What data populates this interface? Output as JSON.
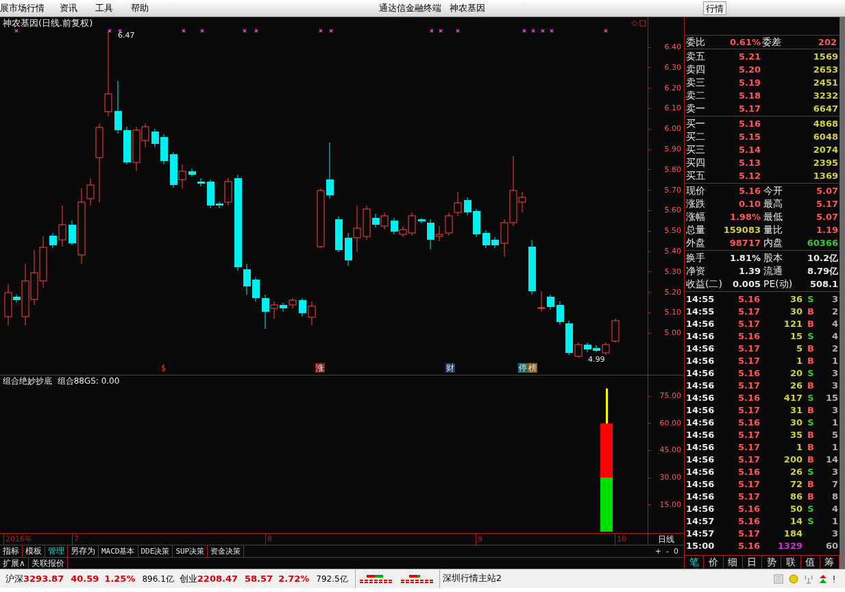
{
  "menu_bar": {
    "items": [
      "展市场行情",
      "资讯",
      "工具",
      "帮助"
    ],
    "app_title": "通达信金融终端",
    "stock_name": "神农基因",
    "buttons": [
      "行情"
    ]
  },
  "chart": {
    "title": "神农基因(日线.前复权)",
    "high_label": "6.47",
    "low_label": "4.99",
    "price_ticks": [
      "6.40",
      "6.30",
      "6.20",
      "6.10",
      "6.00",
      "5.90",
      "5.80",
      "5.70",
      "5.60",
      "5.50",
      "5.40",
      "5.30",
      "5.20",
      "5.10",
      "5.00"
    ],
    "event_tags": [
      {
        "label": "$",
        "color": "#000000"
      },
      {
        "label": "涨",
        "color": "#8b1a1a"
      },
      {
        "label": "财",
        "color": "#1a3a6b"
      },
      {
        "label": "停",
        "color": "#1a6b6b"
      },
      {
        "label": "榜",
        "color": "#8b5a1a"
      }
    ]
  },
  "indicator": {
    "title": "组合绝妙抄底  组合88GS: 0.00",
    "ticks": [
      "75.00",
      "60.00",
      "45.00",
      "30.00",
      "15.00"
    ]
  },
  "date_axis": {
    "labels": [
      "2016年",
      "7",
      "8",
      "9",
      "10"
    ],
    "period": "日线"
  },
  "formula_tabs": [
    {
      "label": "指标",
      "selected": false
    },
    {
      "label": "模板",
      "selected": false
    },
    {
      "label": "管理",
      "selected": true
    },
    {
      "label": "另存为",
      "selected": false
    },
    {
      "label": "MACD基本",
      "selected": false
    },
    {
      "label": "DDE决策",
      "selected": false
    },
    {
      "label": "SUP决策",
      "selected": false
    },
    {
      "label": "资金决策",
      "selected": false
    }
  ],
  "zoom_controls": [
    "+",
    "-",
    "0"
  ],
  "extra_tabs": [
    "扩展∧",
    "关联报价"
  ],
  "quote_panel": {
    "ratio": [
      {
        "label": "委比",
        "value": "0.61%",
        "kind": "up"
      },
      {
        "label": "委差",
        "value": "202",
        "kind": "up"
      }
    ],
    "asks": [
      {
        "label": "卖五",
        "price": "5.21",
        "volume": "1569"
      },
      {
        "label": "卖四",
        "price": "5.20",
        "volume": "2653"
      },
      {
        "label": "卖三",
        "price": "5.19",
        "volume": "2451"
      },
      {
        "label": "卖二",
        "price": "5.18",
        "volume": "3232"
      },
      {
        "label": "卖一",
        "price": "5.17",
        "volume": "6647"
      }
    ],
    "bids": [
      {
        "label": "买一",
        "price": "5.16",
        "volume": "4868"
      },
      {
        "label": "买二",
        "price": "5.15",
        "volume": "6048"
      },
      {
        "label": "买三",
        "price": "5.14",
        "volume": "2074"
      },
      {
        "label": "买四",
        "price": "5.13",
        "volume": "2395"
      },
      {
        "label": "买五",
        "price": "5.12",
        "volume": "1369"
      }
    ],
    "stats": [
      {
        "label": "现价",
        "value": "5.16",
        "kind": "up"
      },
      {
        "label": "今开",
        "value": "5.07",
        "kind": "up"
      },
      {
        "label": "涨跌",
        "value": "0.10",
        "kind": "up"
      },
      {
        "label": "最高",
        "value": "5.17",
        "kind": "up"
      },
      {
        "label": "涨幅",
        "value": "1.98%",
        "kind": "up"
      },
      {
        "label": "最低",
        "value": "5.07",
        "kind": "up"
      },
      {
        "label": "总量",
        "value": "159083",
        "kind": "volume"
      },
      {
        "label": "量比",
        "value": "1.19",
        "kind": "up"
      },
      {
        "label": "外盘",
        "value": "98717",
        "kind": "up"
      },
      {
        "label": "内盘",
        "value": "60366",
        "kind": "down"
      }
    ],
    "fundamentals": [
      {
        "label": "换手",
        "value": "1.81%",
        "kind": "plain"
      },
      {
        "label": "股本",
        "value": "10.2亿",
        "kind": "plain"
      },
      {
        "label": "净资",
        "value": "1.39",
        "kind": "plain"
      },
      {
        "label": "流通",
        "value": "8.79亿",
        "kind": "plain"
      },
      {
        "label": "收益(二)",
        "value": "0.005",
        "kind": "plain"
      },
      {
        "label": "PE(动)",
        "value": "508.1",
        "kind": "plain"
      }
    ],
    "trades": [
      {
        "time": "14:55",
        "price": "5.16",
        "volume": "36",
        "side": "S",
        "count": "3",
        "kind": "sell"
      },
      {
        "time": "14:55",
        "price": "5.17",
        "volume": "30",
        "side": "B",
        "count": "2",
        "kind": "buy"
      },
      {
        "time": "14:56",
        "price": "5.17",
        "volume": "121",
        "side": "B",
        "count": "4",
        "kind": "buy"
      },
      {
        "time": "14:56",
        "price": "5.16",
        "volume": "15",
        "side": "S",
        "count": "4",
        "kind": "sell"
      },
      {
        "time": "14:56",
        "price": "5.17",
        "volume": "5",
        "side": "B",
        "count": "2",
        "kind": "buy"
      },
      {
        "time": "14:56",
        "price": "5.17",
        "volume": "1",
        "side": "B",
        "count": "1",
        "kind": "buy"
      },
      {
        "time": "14:56",
        "price": "5.16",
        "volume": "20",
        "side": "S",
        "count": "3",
        "kind": "sell"
      },
      {
        "time": "14:56",
        "price": "5.17",
        "volume": "26",
        "side": "B",
        "count": "3",
        "kind": "buy"
      },
      {
        "time": "14:56",
        "price": "5.16",
        "volume": "417",
        "side": "S",
        "count": "15",
        "kind": "sell"
      },
      {
        "time": "14:56",
        "price": "5.17",
        "volume": "31",
        "side": "B",
        "count": "3",
        "kind": "buy"
      },
      {
        "time": "14:56",
        "price": "5.16",
        "volume": "30",
        "side": "S",
        "count": "1",
        "kind": "sell"
      },
      {
        "time": "14:56",
        "price": "5.17",
        "volume": "35",
        "side": "B",
        "count": "5",
        "kind": "buy"
      },
      {
        "time": "14:56",
        "price": "5.17",
        "volume": "1",
        "side": "B",
        "count": "1",
        "kind": "buy"
      },
      {
        "time": "14:56",
        "price": "5.17",
        "volume": "200",
        "side": "B",
        "count": "14",
        "kind": "buy"
      },
      {
        "time": "14:56",
        "price": "5.16",
        "volume": "26",
        "side": "S",
        "count": "3",
        "kind": "sell"
      },
      {
        "time": "14:56",
        "price": "5.17",
        "volume": "72",
        "side": "B",
        "count": "7",
        "kind": "buy"
      },
      {
        "time": "14:56",
        "price": "5.17",
        "volume": "86",
        "side": "B",
        "count": "8",
        "kind": "buy"
      },
      {
        "time": "14:56",
        "price": "5.16",
        "volume": "50",
        "side": "S",
        "count": "4",
        "kind": "sell"
      },
      {
        "time": "14:57",
        "price": "5.16",
        "volume": "14",
        "side": "S",
        "count": "1",
        "kind": "sell"
      },
      {
        "time": "14:57",
        "price": "5.17",
        "volume": "184",
        "count": "3",
        "kind": "plain"
      },
      {
        "time": "15:00",
        "price": "5.16",
        "volume": "1329",
        "count": "60",
        "kind": "closing"
      }
    ],
    "tabs": [
      {
        "label": "笔",
        "selected": true
      },
      {
        "label": "价",
        "selected": false
      },
      {
        "label": "细",
        "selected": false
      },
      {
        "label": "日",
        "selected": false
      },
      {
        "label": "势",
        "selected": false
      },
      {
        "label": "联",
        "selected": false
      },
      {
        "label": "值",
        "selected": false
      },
      {
        "label": "筹",
        "selected": false
      }
    ]
  },
  "status_bar": {
    "indices": [
      {
        "name": "沪深",
        "value": "3293.87",
        "change": "40.59",
        "percent": "1.25%",
        "turnover": "896.1亿"
      },
      {
        "name": "创业",
        "value": "2208.47",
        "change": "58.57",
        "percent": "2.72%",
        "turnover": "792.5亿"
      }
    ],
    "server": "深圳行情主站2"
  }
}
